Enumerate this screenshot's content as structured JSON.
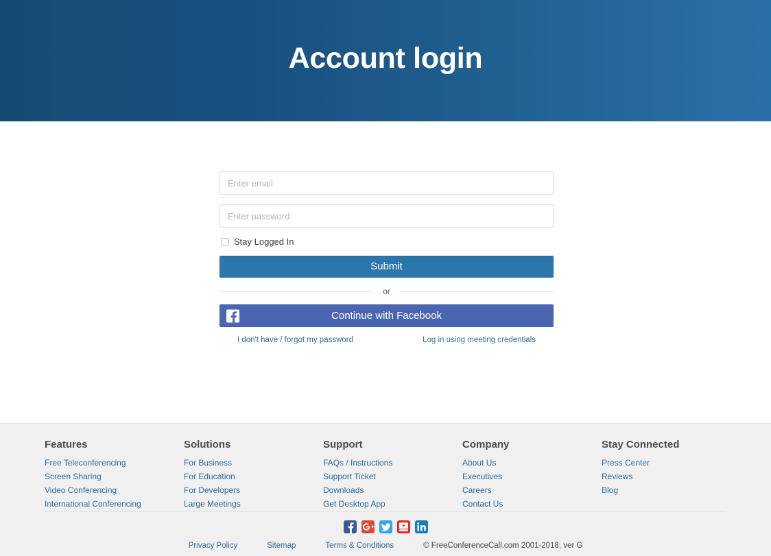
{
  "hero": {
    "title": "Account login",
    "gradient_from": "#174a72",
    "gradient_to": "#2a70a8"
  },
  "form": {
    "email": {
      "placeholder": "Enter email",
      "value": ""
    },
    "password": {
      "placeholder": "Enter password",
      "value": ""
    },
    "stay_logged_in_label": "Stay Logged In",
    "stay_logged_in_checked": false,
    "submit_label": "Submit",
    "or_label": "or",
    "facebook_label": "Continue with Facebook",
    "facebook_color": "#4a66b0",
    "submit_color": "#2b76ab",
    "forgot_password_label": "I don't have / forgot my password",
    "meeting_credentials_label": "Log in using meeting credentials"
  },
  "footer": {
    "columns": [
      {
        "heading": "Features",
        "links": [
          "Free Teleconferencing",
          "Screen Sharing",
          "Video Conferencing",
          "International Conferencing"
        ]
      },
      {
        "heading": "Solutions",
        "links": [
          "For Business",
          "For Education",
          "For Developers",
          "Large Meetings"
        ]
      },
      {
        "heading": "Support",
        "links": [
          "FAQs / Instructions",
          "Support Ticket",
          "Downloads",
          "Get Desktop App"
        ]
      },
      {
        "heading": "Company",
        "links": [
          "About Us",
          "Executives",
          "Careers",
          "Contact Us"
        ]
      },
      {
        "heading": "Stay Connected",
        "links": [
          "Press Center",
          "Reviews",
          "Blog"
        ]
      }
    ],
    "social": [
      {
        "name": "facebook-icon",
        "color": "#3b5998"
      },
      {
        "name": "google-plus-icon",
        "color": "#dd4b39"
      },
      {
        "name": "twitter-icon",
        "color": "#2fa8e8"
      },
      {
        "name": "youtube-icon",
        "color": "#e02a22"
      },
      {
        "name": "linkedin-icon",
        "color": "#1b7bb9"
      }
    ],
    "bottom_links": [
      "Privacy Policy",
      "Sitemap",
      "Terms & Conditions"
    ],
    "copyright": "© FreeConferenceCall.com 2001-2018, ver G"
  }
}
